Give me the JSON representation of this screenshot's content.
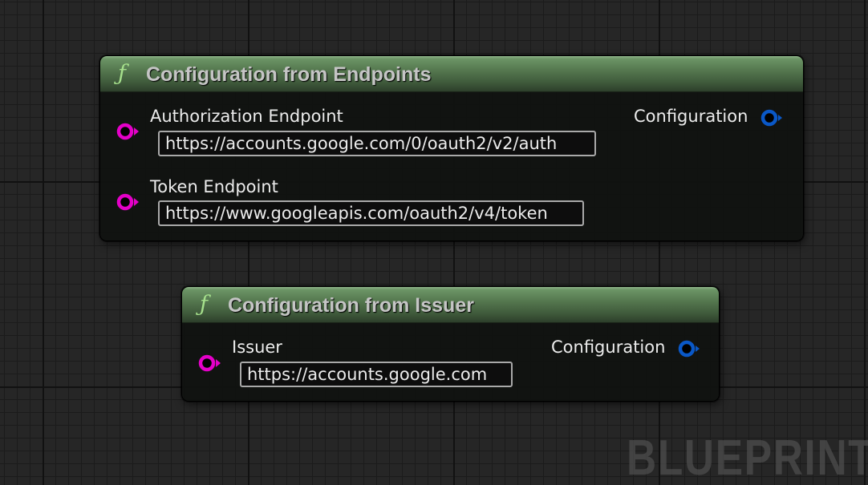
{
  "nodes": [
    {
      "title": "Configuration from Endpoints",
      "icon": "function-icon",
      "inputs": [
        {
          "label": "Authorization Endpoint",
          "value": "https://accounts.google.com/0/oauth2/v2/auth"
        },
        {
          "label": "Token Endpoint",
          "value": "https://www.googleapis.com/oauth2/v4/token"
        }
      ],
      "output": {
        "label": "Configuration"
      }
    },
    {
      "title": "Configuration from Issuer",
      "icon": "function-icon",
      "inputs": [
        {
          "label": "Issuer",
          "value": "https://accounts.google.com"
        }
      ],
      "output": {
        "label": "Configuration"
      }
    }
  ],
  "icon_glyph": "ƒ",
  "watermark": "BLUEPRINT",
  "colors": {
    "header_green": "#55784f",
    "string_pin": "#e400c8",
    "struct_pin": "#0a58c7",
    "function_icon": "#a6e08c"
  }
}
